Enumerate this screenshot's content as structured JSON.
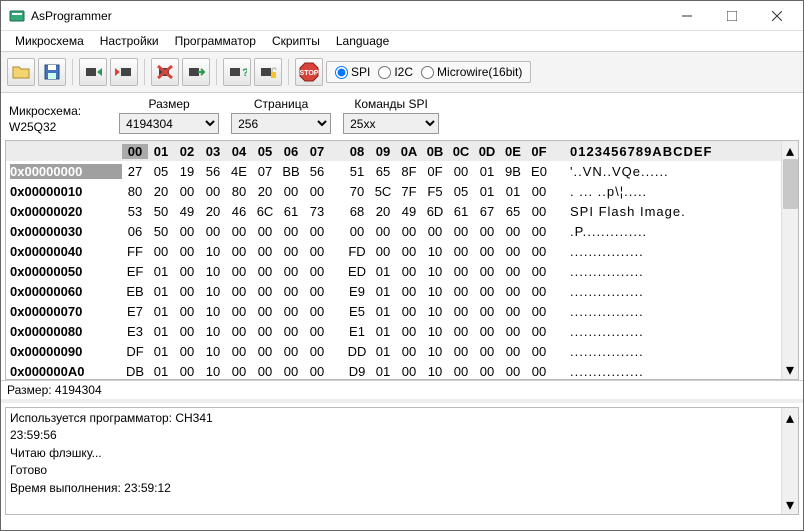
{
  "window": {
    "title": "AsProgrammer"
  },
  "menu": {
    "m0": "Микросхема",
    "m1": "Настройки",
    "m2": "Программатор",
    "m3": "Скрипты",
    "m4": "Language"
  },
  "radio": {
    "r0": "SPI",
    "r1": "I2C",
    "r2": "Microwire(16bit)"
  },
  "params": {
    "chip_label": "Микросхема:",
    "chip_value": "W25Q32",
    "size_label": "Размер",
    "size_value": "4194304",
    "page_label": "Страница",
    "page_value": "256",
    "cmd_label": "Команды SPI",
    "cmd_value": "25xx"
  },
  "hex": {
    "header": {
      "cols": [
        "00",
        "01",
        "02",
        "03",
        "04",
        "05",
        "06",
        "07",
        "08",
        "09",
        "0A",
        "0B",
        "0C",
        "0D",
        "0E",
        "0F"
      ],
      "ascii": "0123456789ABCDEF"
    },
    "rows": [
      {
        "addr": "0x00000000",
        "b": [
          "27",
          "05",
          "19",
          "56",
          "4E",
          "07",
          "BB",
          "56",
          "51",
          "65",
          "8F",
          "0F",
          "00",
          "01",
          "9B",
          "E0"
        ],
        "a": "'..VN..VQe......"
      },
      {
        "addr": "0x00000010",
        "b": [
          "80",
          "20",
          "00",
          "00",
          "80",
          "20",
          "00",
          "00",
          "70",
          "5C",
          "7F",
          "F5",
          "05",
          "01",
          "01",
          "00"
        ],
        "a": ". ... ..p\\¦....."
      },
      {
        "addr": "0x00000020",
        "b": [
          "53",
          "50",
          "49",
          "20",
          "46",
          "6C",
          "61",
          "73",
          "68",
          "20",
          "49",
          "6D",
          "61",
          "67",
          "65",
          "00"
        ],
        "a": "SPI Flash Image."
      },
      {
        "addr": "0x00000030",
        "b": [
          "06",
          "50",
          "00",
          "00",
          "00",
          "00",
          "00",
          "00",
          "00",
          "00",
          "00",
          "00",
          "00",
          "00",
          "00",
          "00"
        ],
        "a": ".P.............."
      },
      {
        "addr": "0x00000040",
        "b": [
          "FF",
          "00",
          "00",
          "10",
          "00",
          "00",
          "00",
          "00",
          "FD",
          "00",
          "00",
          "10",
          "00",
          "00",
          "00",
          "00"
        ],
        "a": "................"
      },
      {
        "addr": "0x00000050",
        "b": [
          "EF",
          "01",
          "00",
          "10",
          "00",
          "00",
          "00",
          "00",
          "ED",
          "01",
          "00",
          "10",
          "00",
          "00",
          "00",
          "00"
        ],
        "a": "................"
      },
      {
        "addr": "0x00000060",
        "b": [
          "EB",
          "01",
          "00",
          "10",
          "00",
          "00",
          "00",
          "00",
          "E9",
          "01",
          "00",
          "10",
          "00",
          "00",
          "00",
          "00"
        ],
        "a": "................"
      },
      {
        "addr": "0x00000070",
        "b": [
          "E7",
          "01",
          "00",
          "10",
          "00",
          "00",
          "00",
          "00",
          "E5",
          "01",
          "00",
          "10",
          "00",
          "00",
          "00",
          "00"
        ],
        "a": "................"
      },
      {
        "addr": "0x00000080",
        "b": [
          "E3",
          "01",
          "00",
          "10",
          "00",
          "00",
          "00",
          "00",
          "E1",
          "01",
          "00",
          "10",
          "00",
          "00",
          "00",
          "00"
        ],
        "a": "................"
      },
      {
        "addr": "0x00000090",
        "b": [
          "DF",
          "01",
          "00",
          "10",
          "00",
          "00",
          "00",
          "00",
          "DD",
          "01",
          "00",
          "10",
          "00",
          "00",
          "00",
          "00"
        ],
        "a": "................"
      },
      {
        "addr": "0x000000A0",
        "b": [
          "DB",
          "01",
          "00",
          "10",
          "00",
          "00",
          "00",
          "00",
          "D9",
          "01",
          "00",
          "10",
          "00",
          "00",
          "00",
          "00"
        ],
        "a": "................"
      }
    ]
  },
  "status": {
    "size_text": "Размер: 4194304"
  },
  "log": {
    "l0": "Используется программатор: CH341",
    "l1": "23:59:56",
    "l2": "Читаю флэшку...",
    "l3": "Готово",
    "l4": "Время выполнения: 23:59:12"
  }
}
